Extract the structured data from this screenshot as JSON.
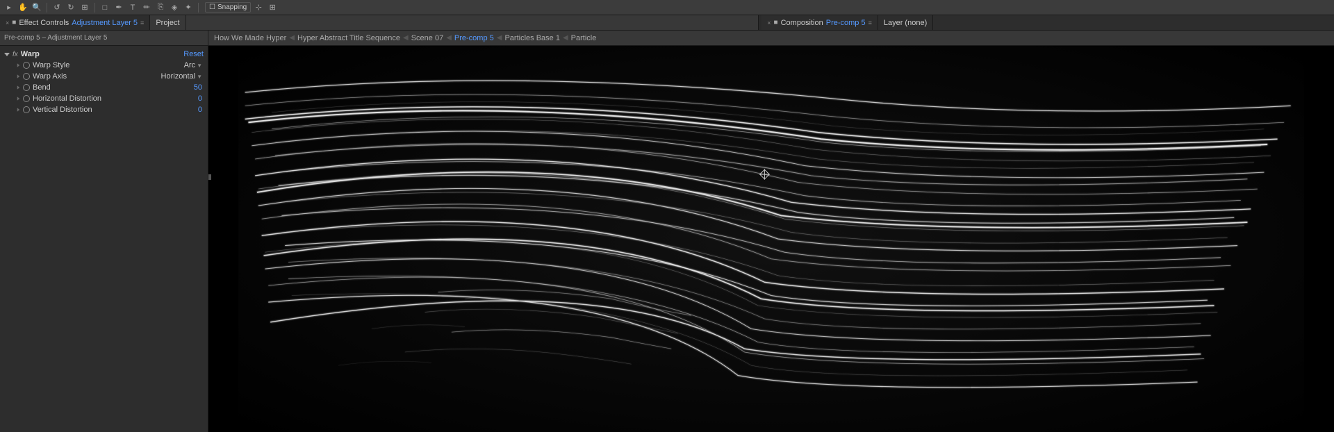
{
  "toolbar": {
    "snapping_label": "Snapping",
    "tools": [
      "arrow",
      "hand",
      "zoom",
      "rotate",
      "shape",
      "pen",
      "text",
      "brush",
      "eraser",
      "stamp",
      "pin",
      "puppet"
    ]
  },
  "panels": {
    "effect_controls": {
      "tab_label": "Effect Controls",
      "layer_name": "Adjustment Layer 5",
      "close": "×",
      "menu": "≡"
    },
    "project": {
      "tab_label": "Project"
    },
    "composition": {
      "tab_label": "Composition",
      "comp_name": "Pre-comp 5",
      "close": "×",
      "menu": "≡"
    },
    "layer": {
      "tab_label": "Layer (none)"
    }
  },
  "breadcrumb": {
    "items": [
      {
        "label": "How We Made Hyper",
        "active": false
      },
      {
        "label": "Hyper Abstract Title Sequence",
        "active": false
      },
      {
        "label": "Scene 07",
        "active": false
      },
      {
        "label": "Pre-comp 5",
        "active": true
      },
      {
        "label": "Particles Base 1",
        "active": false
      },
      {
        "label": "Particle",
        "active": false
      }
    ]
  },
  "panel_header": {
    "comp_label": "Pre-comp 5 – Adjustment Layer 5"
  },
  "warp_effect": {
    "section_name": "Warp",
    "reset_label": "Reset",
    "fx_label": "fx",
    "properties": [
      {
        "name": "Warp Style",
        "value": "Arc",
        "type": "dropdown"
      },
      {
        "name": "Warp Axis",
        "value": "Horizontal",
        "type": "dropdown"
      },
      {
        "name": "Bend",
        "value": "50",
        "type": "number",
        "color": "blue"
      },
      {
        "name": "Horizontal Distortion",
        "value": "0",
        "type": "number",
        "color": "blue"
      },
      {
        "name": "Vertical Distortion",
        "value": "0",
        "type": "number",
        "color": "blue"
      }
    ]
  },
  "colors": {
    "blue_accent": "#5599ff",
    "bg_dark": "#000000",
    "panel_bg": "#2d2d2d",
    "toolbar_bg": "#3c3c3c"
  }
}
